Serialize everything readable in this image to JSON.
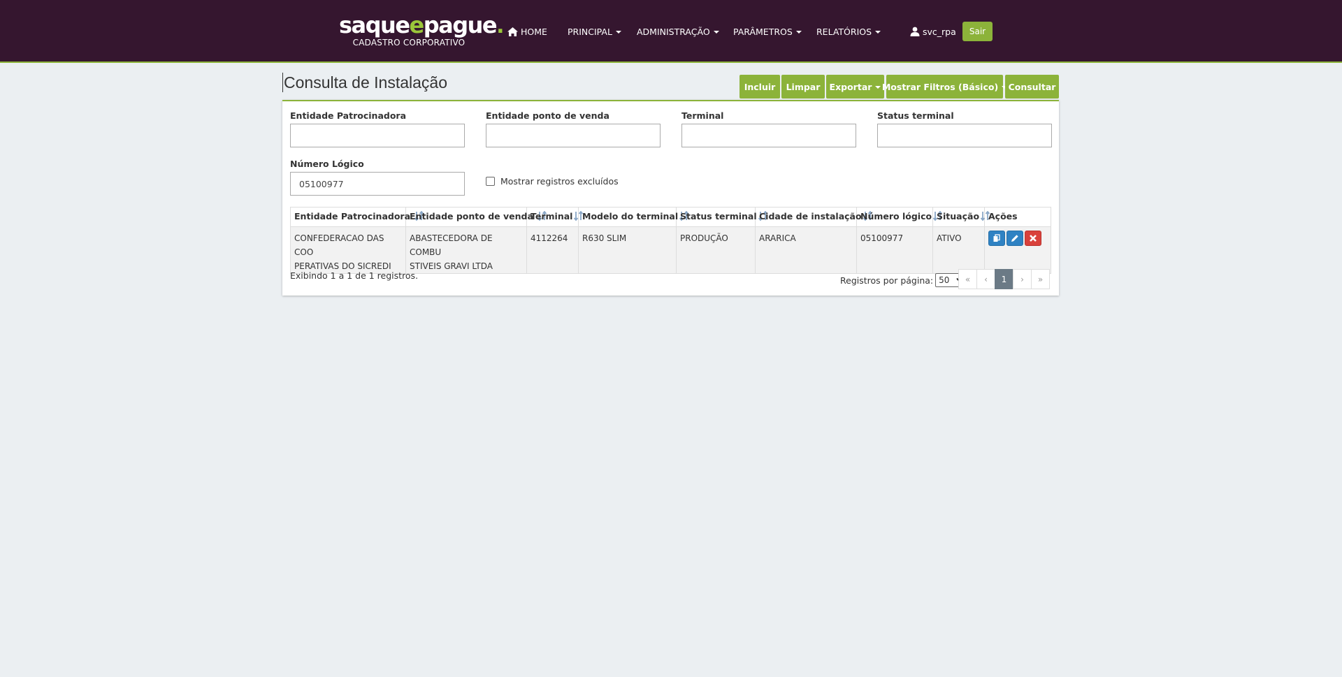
{
  "brand": {
    "logo_part1": "saque",
    "logo_e": "e",
    "logo_part2": "pague",
    "logo_dot": ".",
    "subtitle": "CADASTRO CORPORATIVO"
  },
  "nav": {
    "home": "HOME",
    "principal": "PRINCIPAL",
    "administracao": "ADMINISTRAÇÃO",
    "parametros": "PARÂMETROS",
    "relatorios": "RELATÓRIOS",
    "username": "svc_rpa",
    "logout": "Sair"
  },
  "page": {
    "title": "Consulta de Instalação"
  },
  "toolbar": {
    "incluir": "Incluir",
    "limpar": "Limpar",
    "exportar": "Exportar",
    "mostrar_filtros": "Mostrar Filtros (Básico)",
    "consultar": "Consultar"
  },
  "filters": {
    "entidade_patrocinadora": {
      "label": "Entidade Patrocinadora",
      "value": ""
    },
    "entidade_ponto_venda": {
      "label": "Entidade ponto de venda",
      "value": ""
    },
    "terminal": {
      "label": "Terminal",
      "value": ""
    },
    "status_terminal": {
      "label": "Status terminal",
      "value": ""
    },
    "numero_logico": {
      "label": "Número Lógico",
      "value": "05100977"
    },
    "mostrar_excluidos": {
      "label": "Mostrar registros excluídos",
      "checked": false
    }
  },
  "table": {
    "columns": [
      "Entidade Patrocinadora",
      "Entidade ponto de venda",
      "Terminal",
      "Modelo do terminal",
      "Status terminal",
      "Cidade de instalação",
      "Número lógico",
      "Situação",
      "Ações"
    ],
    "rows": [
      {
        "entidade_patrocinadora_l1": "CONFEDERACAO DAS COO",
        "entidade_patrocinadora_l2": "PERATIVAS DO SICREDI",
        "entidade_ponto_venda_l1": "ABASTECEDORA DE COMBU",
        "entidade_ponto_venda_l2": "STIVEIS GRAVI LTDA",
        "terminal": "4112264",
        "modelo": "R630 SLIM",
        "status": "PRODUÇÃO",
        "cidade": "ARARICA",
        "numero_logico": "05100977",
        "situacao": "ATIVO"
      }
    ]
  },
  "footer": {
    "info": "Exibindo 1 a 1 de 1 registros.",
    "per_page_label": "Registros por página:",
    "per_page_value": "50",
    "pager": {
      "first": "«",
      "prev": "‹",
      "current": "1",
      "next": "›",
      "last": "»"
    }
  },
  "colors": {
    "navbar_bg": "#35162f",
    "accent_green": "#8cb33a",
    "action_blue": "#2f82c3",
    "action_red": "#d9413b",
    "page_bg": "#ebeff2"
  }
}
